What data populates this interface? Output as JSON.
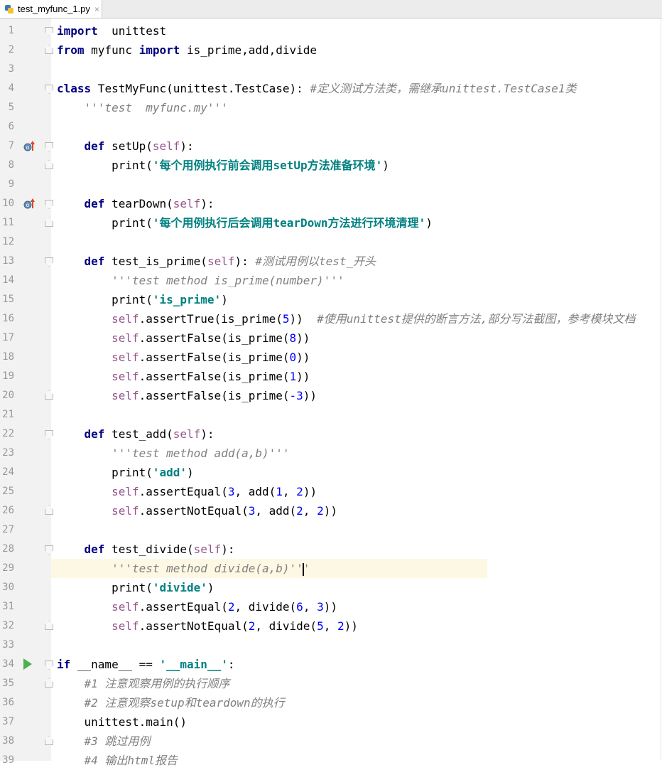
{
  "tab": {
    "filename": "test_myfunc_1.py",
    "close": "×"
  },
  "lines": [
    {
      "n": "1",
      "t": [
        [
          "kw",
          "import"
        ],
        [
          "",
          "  unittest"
        ]
      ]
    },
    {
      "n": "2",
      "t": [
        [
          "kw",
          "from"
        ],
        [
          "",
          " myfunc "
        ],
        [
          "kw",
          "import"
        ],
        [
          "",
          " is_prime,add,divide"
        ]
      ]
    },
    {
      "n": "3",
      "t": []
    },
    {
      "n": "4",
      "t": [
        [
          "kw",
          "class"
        ],
        [
          "",
          " TestMyFunc(unittest.TestCase): "
        ],
        [
          "cmt",
          "#定义测试方法类，需继承unittest.TestCase1类"
        ]
      ]
    },
    {
      "n": "5",
      "t": [
        [
          "",
          "    "
        ],
        [
          "doc",
          "'''test  myfunc.my'''"
        ]
      ]
    },
    {
      "n": "6",
      "t": []
    },
    {
      "n": "7",
      "t": [
        [
          "",
          "    "
        ],
        [
          "kw",
          "def"
        ],
        [
          "",
          " setUp("
        ],
        [
          "slf",
          "self"
        ],
        [
          "",
          "):"
        ]
      ]
    },
    {
      "n": "8",
      "t": [
        [
          "",
          "        print("
        ],
        [
          "str",
          "'每个用例执行前会调用setUp方法准备环境'"
        ],
        [
          "",
          ")"
        ]
      ]
    },
    {
      "n": "9",
      "t": []
    },
    {
      "n": "10",
      "t": [
        [
          "",
          "    "
        ],
        [
          "kw",
          "def"
        ],
        [
          "",
          " tearDown("
        ],
        [
          "slf",
          "self"
        ],
        [
          "",
          "):"
        ]
      ]
    },
    {
      "n": "11",
      "t": [
        [
          "",
          "        print("
        ],
        [
          "str",
          "'每个用例执行后会调用tearDown方法进行环境清理'"
        ],
        [
          "",
          ")"
        ]
      ]
    },
    {
      "n": "12",
      "t": []
    },
    {
      "n": "13",
      "t": [
        [
          "",
          "    "
        ],
        [
          "kw",
          "def"
        ],
        [
          "",
          " test_is_prime("
        ],
        [
          "slf",
          "self"
        ],
        [
          "",
          "): "
        ],
        [
          "cmt",
          "#测试用例以test_开头"
        ]
      ]
    },
    {
      "n": "14",
      "t": [
        [
          "",
          "        "
        ],
        [
          "doc",
          "'''test method is_prime(number)'''"
        ]
      ]
    },
    {
      "n": "15",
      "t": [
        [
          "",
          "        print("
        ],
        [
          "str",
          "'is_prime'"
        ],
        [
          "",
          ")"
        ]
      ]
    },
    {
      "n": "16",
      "t": [
        [
          "",
          "        "
        ],
        [
          "slf",
          "self"
        ],
        [
          "",
          ".assertTrue(is_prime("
        ],
        [
          "num",
          "5"
        ],
        [
          "",
          "))  "
        ],
        [
          "cmt",
          "#使用unittest提供的断言方法,部分写法截图，参考模块文档"
        ]
      ]
    },
    {
      "n": "17",
      "t": [
        [
          "",
          "        "
        ],
        [
          "slf",
          "self"
        ],
        [
          "",
          ".assertFalse(is_prime("
        ],
        [
          "num",
          "8"
        ],
        [
          "",
          "))"
        ]
      ]
    },
    {
      "n": "18",
      "t": [
        [
          "",
          "        "
        ],
        [
          "slf",
          "self"
        ],
        [
          "",
          ".assertFalse(is_prime("
        ],
        [
          "num",
          "0"
        ],
        [
          "",
          "))"
        ]
      ]
    },
    {
      "n": "19",
      "t": [
        [
          "",
          "        "
        ],
        [
          "slf",
          "self"
        ],
        [
          "",
          ".assertFalse(is_prime("
        ],
        [
          "num",
          "1"
        ],
        [
          "",
          "))"
        ]
      ]
    },
    {
      "n": "20",
      "t": [
        [
          "",
          "        "
        ],
        [
          "slf",
          "self"
        ],
        [
          "",
          ".assertFalse(is_prime("
        ],
        [
          "num",
          "-3"
        ],
        [
          "",
          "))"
        ]
      ]
    },
    {
      "n": "21",
      "t": []
    },
    {
      "n": "22",
      "t": [
        [
          "",
          "    "
        ],
        [
          "kw",
          "def"
        ],
        [
          "",
          " test_add("
        ],
        [
          "slf",
          "self"
        ],
        [
          "",
          "):"
        ]
      ]
    },
    {
      "n": "23",
      "t": [
        [
          "",
          "        "
        ],
        [
          "doc",
          "'''test method add(a,b)'''"
        ]
      ]
    },
    {
      "n": "24",
      "t": [
        [
          "",
          "        print("
        ],
        [
          "str",
          "'add'"
        ],
        [
          "",
          ")"
        ]
      ]
    },
    {
      "n": "25",
      "t": [
        [
          "",
          "        "
        ],
        [
          "slf",
          "self"
        ],
        [
          "",
          ".assertEqual("
        ],
        [
          "num",
          "3"
        ],
        [
          "",
          ", add("
        ],
        [
          "num",
          "1"
        ],
        [
          "",
          ", "
        ],
        [
          "num",
          "2"
        ],
        [
          "",
          "))"
        ]
      ]
    },
    {
      "n": "26",
      "t": [
        [
          "",
          "        "
        ],
        [
          "slf",
          "self"
        ],
        [
          "",
          ".assertNotEqual("
        ],
        [
          "num",
          "3"
        ],
        [
          "",
          ", add("
        ],
        [
          "num",
          "2"
        ],
        [
          "",
          ", "
        ],
        [
          "num",
          "2"
        ],
        [
          "",
          "))"
        ]
      ]
    },
    {
      "n": "27",
      "t": []
    },
    {
      "n": "28",
      "t": [
        [
          "",
          "    "
        ],
        [
          "kw",
          "def"
        ],
        [
          "",
          " test_divide("
        ],
        [
          "slf",
          "self"
        ],
        [
          "",
          "):"
        ]
      ]
    },
    {
      "n": "29",
      "t": [
        [
          "",
          "        "
        ],
        [
          "doc",
          "'''test method divide(a,b)''"
        ],
        [
          "caret",
          ""
        ],
        [
          "doc",
          "'"
        ]
      ]
    },
    {
      "n": "30",
      "t": [
        [
          "",
          "        print("
        ],
        [
          "str",
          "'divide'"
        ],
        [
          "",
          ")"
        ]
      ]
    },
    {
      "n": "31",
      "t": [
        [
          "",
          "        "
        ],
        [
          "slf",
          "self"
        ],
        [
          "",
          ".assertEqual("
        ],
        [
          "num",
          "2"
        ],
        [
          "",
          ", divide("
        ],
        [
          "num",
          "6"
        ],
        [
          "",
          ", "
        ],
        [
          "num",
          "3"
        ],
        [
          "",
          "))"
        ]
      ]
    },
    {
      "n": "32",
      "t": [
        [
          "",
          "        "
        ],
        [
          "slf",
          "self"
        ],
        [
          "",
          ".assertNotEqual("
        ],
        [
          "num",
          "2"
        ],
        [
          "",
          ", divide("
        ],
        [
          "num",
          "5"
        ],
        [
          "",
          ", "
        ],
        [
          "num",
          "2"
        ],
        [
          "",
          "))"
        ]
      ]
    },
    {
      "n": "33",
      "t": []
    },
    {
      "n": "34",
      "t": [
        [
          "kw",
          "if"
        ],
        [
          "",
          " __name__ == "
        ],
        [
          "str",
          "'__main__'"
        ],
        [
          "",
          ":"
        ]
      ]
    },
    {
      "n": "35",
      "t": [
        [
          "",
          "    "
        ],
        [
          "cmt",
          "#1 注意观察用例的执行顺序"
        ]
      ]
    },
    {
      "n": "36",
      "t": [
        [
          "",
          "    "
        ],
        [
          "cmt",
          "#2 注意观察setup和teardown的执行"
        ]
      ]
    },
    {
      "n": "37",
      "t": [
        [
          "",
          "    unittest.main()"
        ]
      ]
    },
    {
      "n": "38",
      "t": [
        [
          "",
          "    "
        ],
        [
          "cmt",
          "#3 跳过用例"
        ]
      ]
    },
    {
      "n": "39",
      "t": [
        [
          "",
          "    "
        ],
        [
          "cmt",
          "#4 输出html报告"
        ]
      ]
    }
  ],
  "current_line": "29",
  "gutter_markers": {
    "override": [
      "7",
      "10"
    ],
    "run": [
      "34"
    ],
    "fold_open": [
      "1",
      "4",
      "7",
      "10",
      "13",
      "22",
      "28",
      "34"
    ],
    "fold_close": [
      "2",
      "8",
      "11",
      "20",
      "26",
      "32",
      "35",
      "38"
    ]
  },
  "colors": {
    "keyword": "#000080",
    "self": "#94558d",
    "number": "#0000ff",
    "string": "#008080",
    "comment": "#808080",
    "current_line": "#fcf8e3",
    "gutter": "#f2f2f2"
  }
}
